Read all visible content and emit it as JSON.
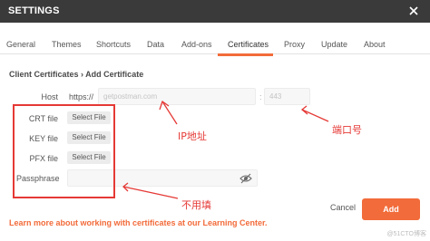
{
  "window": {
    "title": "SETTINGS"
  },
  "tabs": [
    {
      "label": "General"
    },
    {
      "label": "Themes"
    },
    {
      "label": "Shortcuts"
    },
    {
      "label": "Data"
    },
    {
      "label": "Add-ons"
    },
    {
      "label": "Certificates",
      "active": true
    },
    {
      "label": "Proxy"
    },
    {
      "label": "Update"
    },
    {
      "label": "About"
    }
  ],
  "breadcrumb": "Client Certificates  › Add Certificate",
  "form": {
    "host_label": "Host",
    "host_prefix": "https://",
    "host_placeholder": "getpostman.com",
    "port_placeholder": "443",
    "crt_label": "CRT file",
    "key_label": "KEY file",
    "pfx_label": "PFX file",
    "passphrase_label": "Passphrase",
    "select_file_label": "Select File"
  },
  "annotations": {
    "ip": "IP地址",
    "port": "端口号",
    "optional": "不用填"
  },
  "footer": {
    "learn_more": "Learn more about working with certificates at our Learning Center.",
    "cancel_label": "Cancel",
    "add_label": "Add"
  },
  "watermark": "@51CTO博客",
  "colors": {
    "accent": "#f26b3a",
    "titlebar": "#3a3a3a",
    "annotation": "#e53935"
  }
}
